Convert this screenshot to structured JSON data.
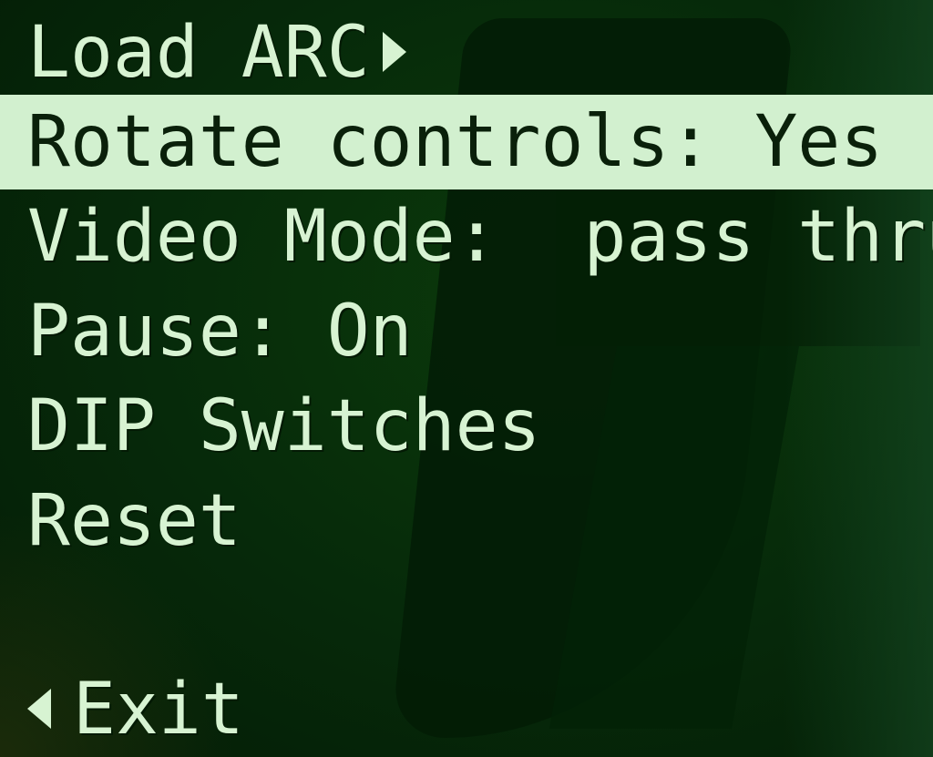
{
  "menu": {
    "load_label": "Load ARC",
    "rotate_label": "Rotate controls: Yes",
    "video_label": "Video Mode:  pass thru",
    "pause_label": "Pause: On",
    "dip_label": "DIP Switches",
    "reset_label": "Reset",
    "exit_label": "Exit"
  },
  "icons": {
    "load_arrow": "submenu-arrow-right-icon",
    "exit_arrow": "back-arrow-left-icon"
  },
  "colors": {
    "background": "#062706",
    "text": "#d7f3d2",
    "highlight_bg": "#d2f0cf",
    "highlight_text": "#0a200a"
  },
  "selected_index": 1
}
